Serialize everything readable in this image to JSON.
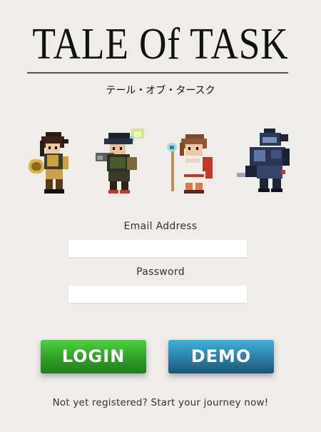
{
  "app": {
    "title": "TALE Of TASK",
    "subtitle": "テール・オブ・タースク"
  },
  "characters": [
    {
      "icon": "warrior-sprite-icon"
    },
    {
      "icon": "mage-sprite-icon"
    },
    {
      "icon": "healer-sprite-icon"
    },
    {
      "icon": "knight-sprite-icon"
    }
  ],
  "form": {
    "email_label": "Email Address",
    "email_value": "",
    "password_label": "Password",
    "password_value": ""
  },
  "buttons": {
    "login_label": "LOGIN",
    "demo_label": "DEMO"
  },
  "footer": {
    "register_text": "Not yet registered? Start your journey now!"
  },
  "colors": {
    "background": "#efedea",
    "login": "#3bb52f",
    "demo": "#2a7fa7"
  }
}
